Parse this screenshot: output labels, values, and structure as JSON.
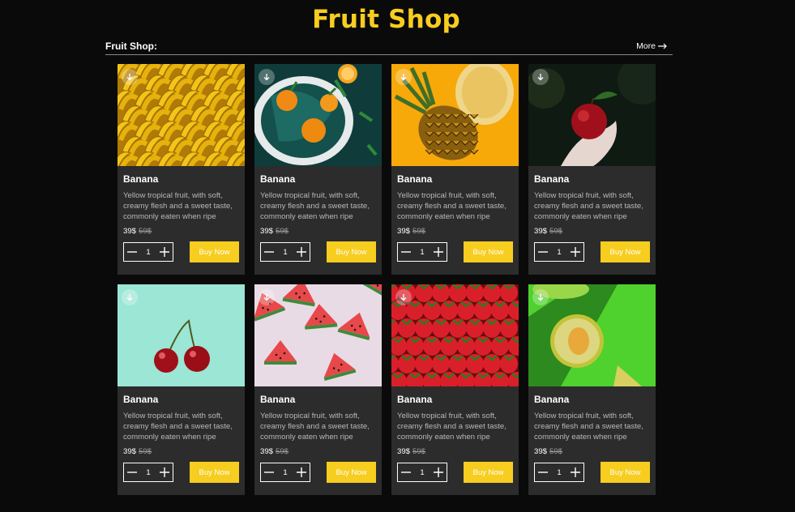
{
  "page": {
    "title": "Fruit Shop"
  },
  "section": {
    "label": "Fruit Shop:",
    "more_label": "More"
  },
  "colors": {
    "accent": "#f7cd1f",
    "background": "#0a0a0a",
    "card": "#2c2c2c"
  },
  "products": [
    {
      "name": "Banana",
      "description": "Yellow tropical fruit, with soft, creamy flesh and a sweet taste, commonly eaten when ripe",
      "price": "39$",
      "old_price": "59$",
      "quantity": "1",
      "buy_label": "Buy Now",
      "photo": "bananas"
    },
    {
      "name": "Banana",
      "description": "Yellow tropical fruit, with soft, creamy flesh and a sweet taste, commonly eaten when ripe",
      "price": "39$",
      "old_price": "59$",
      "quantity": "1",
      "buy_label": "Buy Now",
      "photo": "oranges"
    },
    {
      "name": "Banana",
      "description": "Yellow tropical fruit, with soft, creamy flesh and a sweet taste, commonly eaten when ripe",
      "price": "39$",
      "old_price": "59$",
      "quantity": "1",
      "buy_label": "Buy Now",
      "photo": "pineapple"
    },
    {
      "name": "Banana",
      "description": "Yellow tropical fruit, with soft, creamy flesh and a sweet taste, commonly eaten when ripe",
      "price": "39$",
      "old_price": "59$",
      "quantity": "1",
      "buy_label": "Buy Now",
      "photo": "apple"
    },
    {
      "name": "Banana",
      "description": "Yellow tropical fruit, with soft, creamy flesh and a sweet taste, commonly eaten when ripe",
      "price": "39$",
      "old_price": "59$",
      "quantity": "1",
      "buy_label": "Buy Now",
      "photo": "cherries"
    },
    {
      "name": "Banana",
      "description": "Yellow tropical fruit, with soft, creamy flesh and a sweet taste, commonly eaten when ripe",
      "price": "39$",
      "old_price": "59$",
      "quantity": "1",
      "buy_label": "Buy Now",
      "photo": "watermelon"
    },
    {
      "name": "Banana",
      "description": "Yellow tropical fruit, with soft, creamy flesh and a sweet taste, commonly eaten when ripe",
      "price": "39$",
      "old_price": "59$",
      "quantity": "1",
      "buy_label": "Buy Now",
      "photo": "strawberries"
    },
    {
      "name": "Banana",
      "description": "Yellow tropical fruit, with soft, creamy flesh and a sweet taste, commonly eaten when ripe",
      "price": "39$",
      "old_price": "59$",
      "quantity": "1",
      "buy_label": "Buy Now",
      "photo": "melon"
    }
  ]
}
